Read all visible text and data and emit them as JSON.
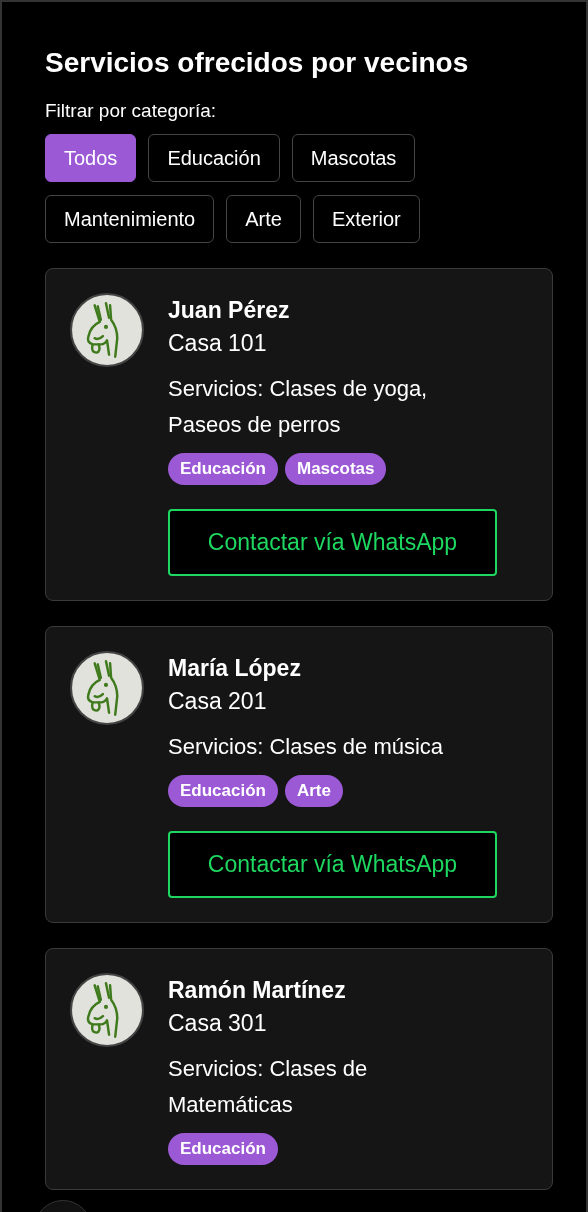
{
  "title": "Servicios ofrecidos por vecinos",
  "filter_label": "Filtrar por categoría:",
  "filters": [
    {
      "label": "Todos",
      "selected": true
    },
    {
      "label": "Educación",
      "selected": false
    },
    {
      "label": "Mascotas",
      "selected": false
    },
    {
      "label": "Mantenimiento",
      "selected": false
    },
    {
      "label": "Arte",
      "selected": false
    },
    {
      "label": "Exterior",
      "selected": false
    }
  ],
  "providers": [
    {
      "name": "Juan Pérez",
      "house": "Casa 101",
      "services": "Servicios: Clases de yoga, Paseos de perros",
      "tags": [
        "Educación",
        "Mascotas"
      ],
      "button": "Contactar vía WhatsApp"
    },
    {
      "name": "María López",
      "house": "Casa 201",
      "services": "Servicios: Clases de música",
      "tags": [
        "Educación",
        "Arte"
      ],
      "button": "Contactar vía WhatsApp"
    },
    {
      "name": "Ramón Martínez",
      "house": "Casa 301",
      "services": "Servicios: Clases de Matemáticas",
      "tags": [
        "Educación"
      ]
    }
  ]
}
